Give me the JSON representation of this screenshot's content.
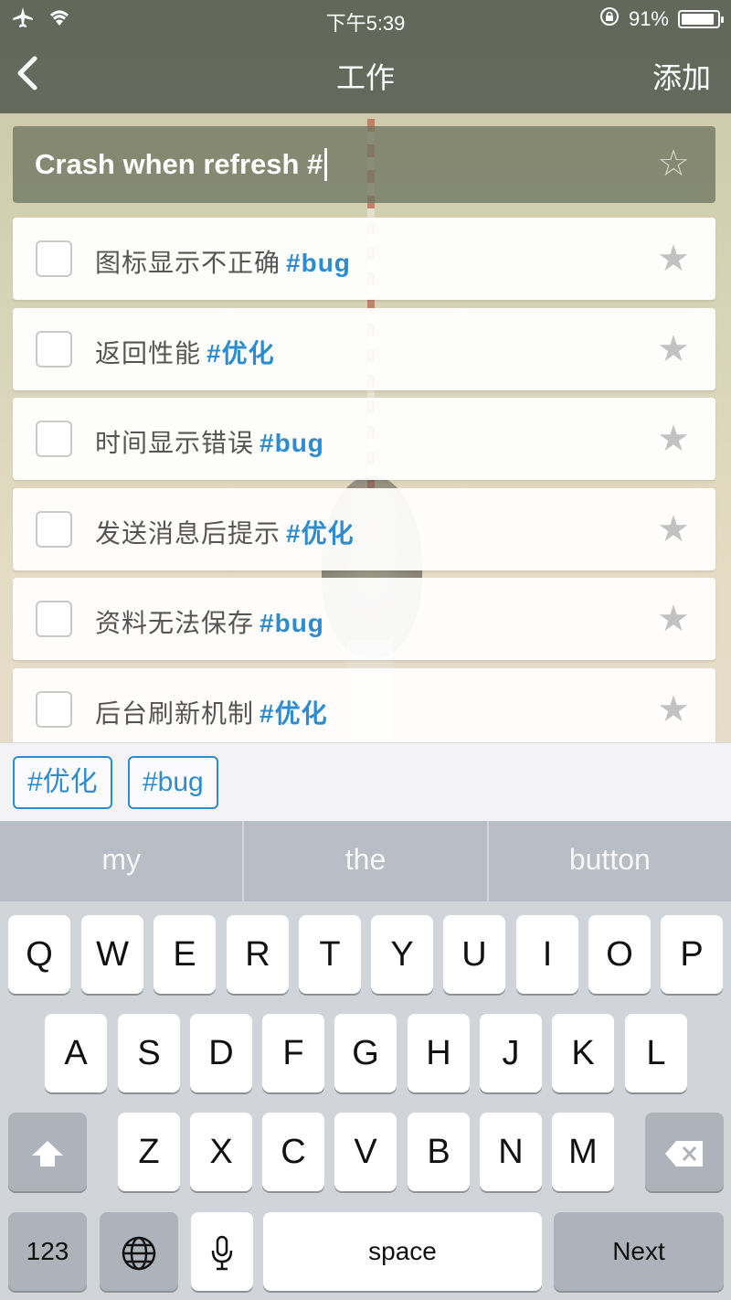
{
  "status_bar": {
    "time": "下午5:39",
    "battery": "91%",
    "battery_level": 0.91,
    "icons": [
      "airplane-icon",
      "wifi-icon",
      "orientation-lock-icon",
      "battery-icon"
    ]
  },
  "nav": {
    "back_icon": "chevron-left-icon",
    "title": "工作",
    "add_label": "添加"
  },
  "new_task": {
    "value": "Crash when refresh #"
  },
  "tasks": [
    {
      "label": "图标显示不正确",
      "tag": "#bug"
    },
    {
      "label": "返回性能",
      "tag": "#优化"
    },
    {
      "label": "时间显示错误",
      "tag": "#bug"
    },
    {
      "label": "发送消息后提示",
      "tag": "#优化"
    },
    {
      "label": "资料无法保存",
      "tag": "#bug"
    },
    {
      "label": "后台刷新机制",
      "tag": "#优化"
    }
  ],
  "tag_suggestions": [
    "#优化",
    "#bug"
  ],
  "keyboard": {
    "predictions": [
      "my",
      "the",
      "button"
    ],
    "row1": [
      "Q",
      "W",
      "E",
      "R",
      "T",
      "Y",
      "U",
      "I",
      "O",
      "P"
    ],
    "row2": [
      "A",
      "S",
      "D",
      "F",
      "G",
      "H",
      "J",
      "K",
      "L"
    ],
    "row3": [
      "Z",
      "X",
      "C",
      "V",
      "B",
      "N",
      "M"
    ],
    "numbers_label": "123",
    "space_label": "space",
    "next_label": "Next"
  },
  "colors": {
    "accent": "#2d8bd0",
    "nav_background": "#50584e",
    "keyboard_background": "#d1d4d9"
  }
}
